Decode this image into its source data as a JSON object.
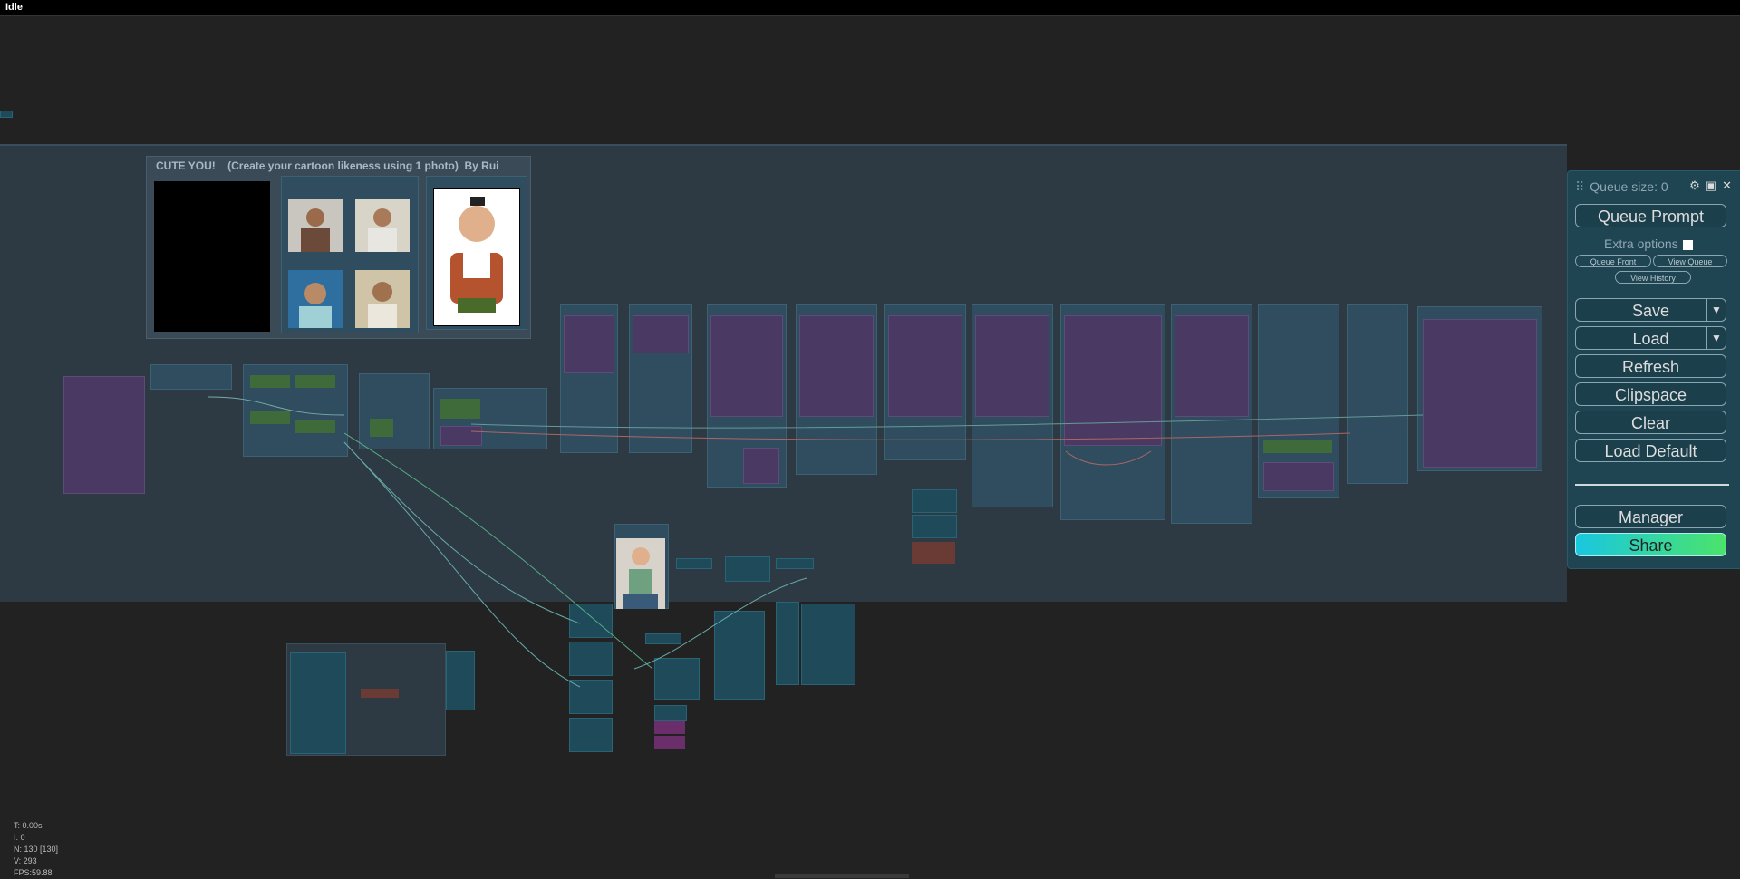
{
  "status": "Idle",
  "group": {
    "title": "CUTE YOU!    (Create your cartoon likeness using 1 photo)  By Rui"
  },
  "queue_panel": {
    "queue_size_label": "Queue size: 0",
    "queue_prompt": "Queue Prompt",
    "extra_options": "Extra options",
    "queue_front": "Queue Front",
    "view_queue": "View Queue",
    "view_history": "View History",
    "save": "Save",
    "load": "Load",
    "refresh": "Refresh",
    "clipspace": "Clipspace",
    "clear": "Clear",
    "load_default": "Load Default",
    "manager": "Manager",
    "share": "Share",
    "dropdown_glyph": "▼"
  },
  "stats": {
    "t": "T: 0.00s",
    "i": "I: 0",
    "n": "N: 130 [130]",
    "v": "V: 293",
    "fps": "FPS:59.88"
  },
  "colors": {
    "canvas_bg": "#222222",
    "group_bg": "#2e3a43",
    "node_bg": "#2f4d5e",
    "panel_bg": "#1f4452",
    "share_gradient": [
      "#19c7e0",
      "#4be36b"
    ]
  }
}
